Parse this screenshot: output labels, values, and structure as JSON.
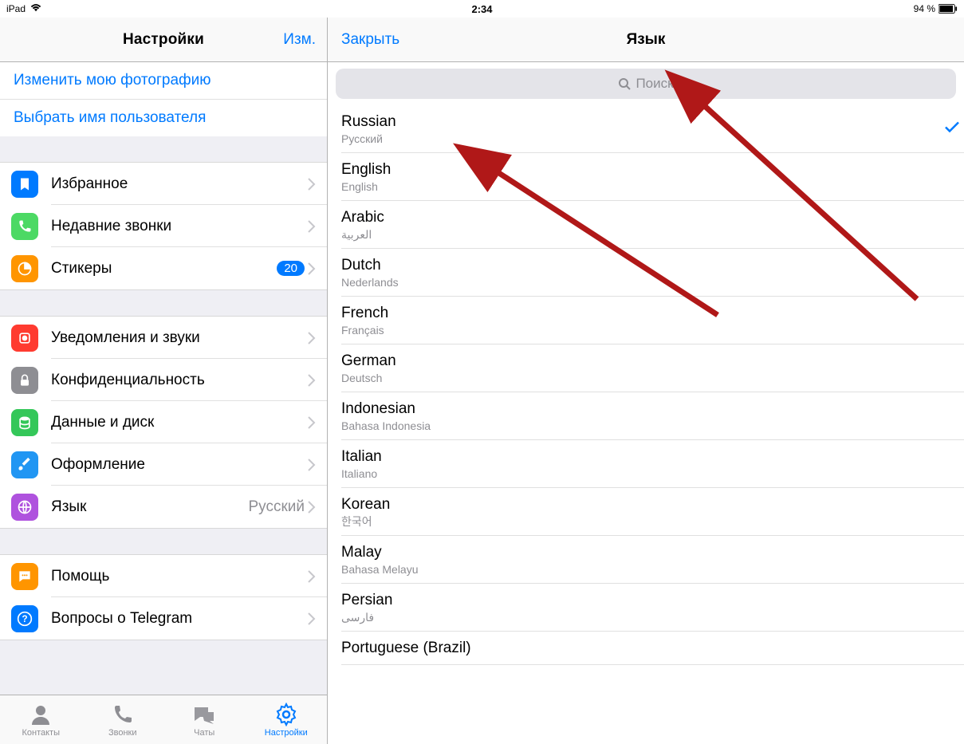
{
  "status": {
    "device": "iPad",
    "time": "2:34",
    "battery": "94 %"
  },
  "leftNav": {
    "title": "Настройки",
    "edit": "Изм."
  },
  "profileLinks": {
    "changePhoto": "Изменить мою фотографию",
    "chooseUsername": "Выбрать имя пользователя"
  },
  "group1": {
    "favorites": "Избранное",
    "recentCalls": "Недавние звонки",
    "stickers": "Стикеры",
    "stickersBadge": "20"
  },
  "group2": {
    "notifications": "Уведомления и звуки",
    "privacy": "Конфиденциальность",
    "data": "Данные и диск",
    "appearance": "Оформление",
    "language": "Язык",
    "languageValue": "Русский"
  },
  "group3": {
    "help": "Помощь",
    "faq": "Вопросы о Telegram"
  },
  "tabs": {
    "contacts": "Контакты",
    "calls": "Звонки",
    "chats": "Чаты",
    "settings": "Настройки"
  },
  "rightNav": {
    "close": "Закрыть",
    "title": "Язык"
  },
  "search": {
    "placeholder": "Поиск"
  },
  "languages": [
    {
      "name": "Russian",
      "sub": "Русский",
      "selected": true
    },
    {
      "name": "English",
      "sub": "English"
    },
    {
      "name": "Arabic",
      "sub": "العربية"
    },
    {
      "name": "Dutch",
      "sub": "Nederlands"
    },
    {
      "name": "French",
      "sub": "Français"
    },
    {
      "name": "German",
      "sub": "Deutsch"
    },
    {
      "name": "Indonesian",
      "sub": "Bahasa Indonesia"
    },
    {
      "name": "Italian",
      "sub": "Italiano"
    },
    {
      "name": "Korean",
      "sub": "한국어"
    },
    {
      "name": "Malay",
      "sub": "Bahasa Melayu"
    },
    {
      "name": "Persian",
      "sub": "فارسی"
    },
    {
      "name": "Portuguese (Brazil)",
      "sub": ""
    }
  ]
}
